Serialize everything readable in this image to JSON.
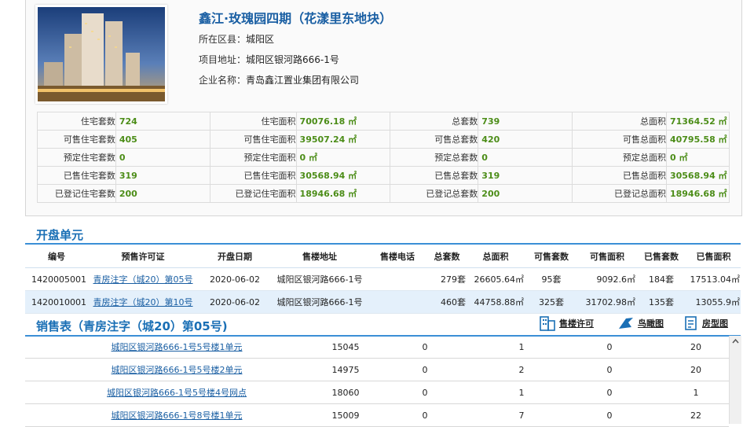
{
  "project": {
    "name": "鑫江·玫瑰园四期（花漾里东地块）",
    "district_label": "所在区县：",
    "district": "城阳区",
    "address_label": "项目地址：",
    "address": "城阳区银河路666-1号",
    "company_label": "企业名称：",
    "company": "青岛鑫江置业集团有限公司"
  },
  "stats": [
    [
      "住宅套数",
      "724",
      "住宅面积",
      "70076.18 ㎡",
      "总套数",
      "739",
      "总面积",
      "71364.52 ㎡"
    ],
    [
      "可售住宅套数",
      "405",
      "可售住宅面积",
      "39507.24 ㎡",
      "可售总套数",
      "420",
      "可售总面积",
      "40795.58 ㎡"
    ],
    [
      "预定住宅套数",
      "0",
      "预定住宅面积",
      "0 ㎡",
      "预定总套数",
      "0",
      "预定总面积",
      "0 ㎡"
    ],
    [
      "已售住宅套数",
      "319",
      "已售住宅面积",
      "30568.94 ㎡",
      "已售总套数",
      "319",
      "已售总面积",
      "30568.94 ㎡"
    ],
    [
      "已登记住宅套数",
      "200",
      "已登记住宅面积",
      "18946.68 ㎡",
      "已登记总套数",
      "200",
      "已登记总面积",
      "18946.68 ㎡"
    ]
  ],
  "units_section": {
    "title": "开盘单元",
    "headers": [
      "编号",
      "预售许可证",
      "开盘日期",
      "售楼地址",
      "售楼电话",
      "总套数",
      "总面积",
      "可售套数",
      "可售面积",
      "已售套数",
      "已售面积"
    ],
    "rows": [
      [
        "1420005001",
        "青房注字（城20）第05号",
        "2020-06-02",
        "城阳区银河路666-1号",
        "",
        "279套",
        "26605.64㎡",
        "95套",
        "9092.6㎡",
        "184套",
        "17513.04㎡"
      ],
      [
        "1420010001",
        "青房注字（城20）第10号",
        "2020-06-02",
        "城阳区银河路666-1号",
        "",
        "460套",
        "44758.88㎡",
        "325套",
        "31702.98㎡",
        "135套",
        "13055.9㎡"
      ]
    ]
  },
  "sales_section": {
    "title": "销售表（青房注字（城20）第05号)",
    "links": [
      "售楼许可",
      "鸟瞰图",
      "房型图"
    ],
    "rows": [
      [
        "城阳区银河路666-1号5号楼1单元",
        "15045",
        "0",
        "1",
        "0",
        "20"
      ],
      [
        "城阳区银河路666-1号5号楼2单元",
        "14975",
        "0",
        "2",
        "0",
        "20"
      ],
      [
        "城阳区银河路666-1号5号楼4号网点",
        "18060",
        "0",
        "1",
        "0",
        "1"
      ],
      [
        "城阳区银河路666-1号8号楼1单元",
        "15009",
        "0",
        "7",
        "0",
        "22"
      ]
    ]
  },
  "colors": {
    "accent": "#1a6fb5",
    "value_green": "#4c8d18",
    "highlight_row": "#e4f0fb"
  },
  "icons": [
    "building-icon",
    "bird-icon",
    "floorplan-icon",
    "scroll-up-icon"
  ]
}
